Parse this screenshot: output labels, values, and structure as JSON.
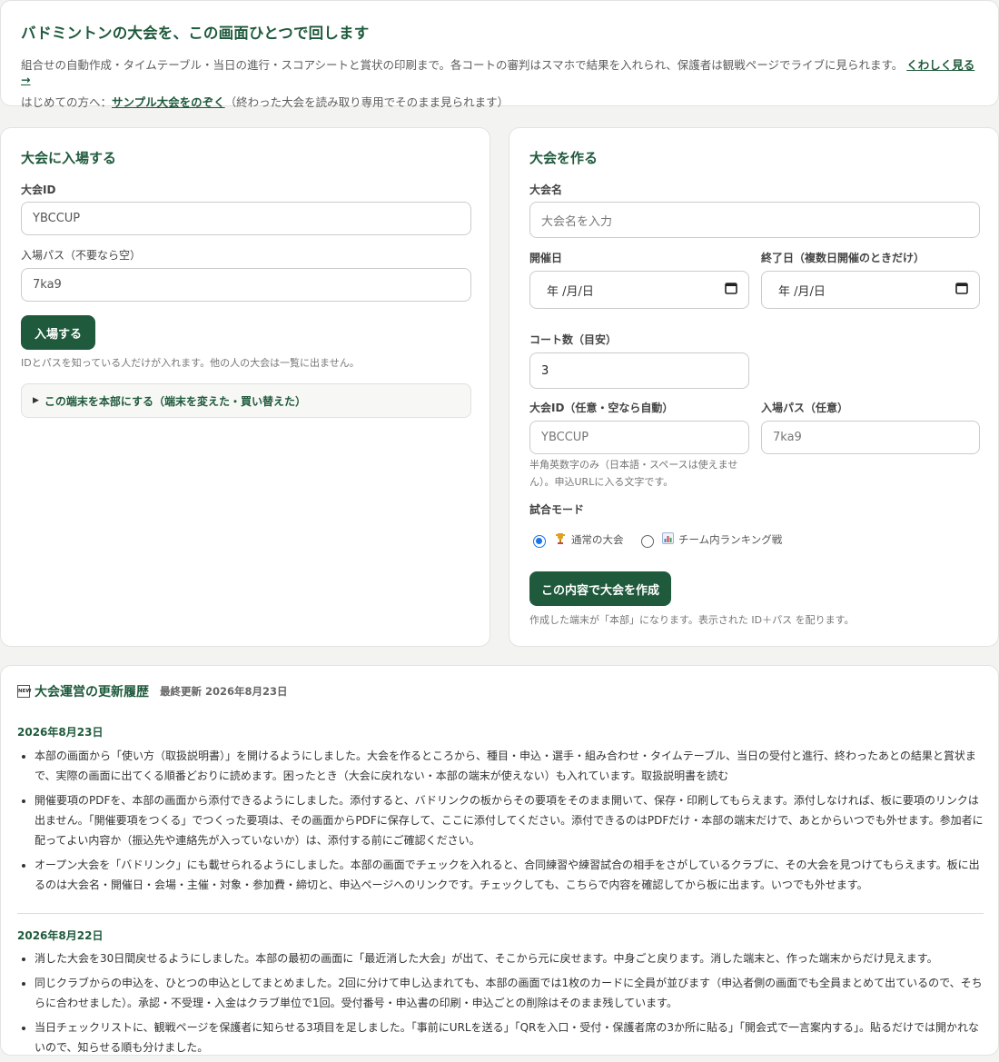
{
  "hero": {
    "title": "バドミントンの大会を、この画面ひとつで回します",
    "desc": "組合せの自動作成・タイムテーブル・当日の進行・スコアシートと賞状の印刷まで。各コートの審判はスマホで結果を入れられ、保護者は観戦ページでライブに見られます。",
    "more_link": "くわしく見る →",
    "first_prefix": "はじめての方へ：",
    "sample_link": "サンプル大会をのぞく",
    "sample_suffix": "（終わった大会を読み取り専用でそのまま見られます）"
  },
  "join": {
    "title": "大会に入場する",
    "id_label": "大会ID",
    "id_value": "YBCCUP",
    "pass_label": "入場パス（不要なら空）",
    "pass_value": "7ka9",
    "button": "入場する",
    "note": "IDとパスを知っている人だけが入れます。他の人の大会は一覧に出ません。",
    "details": "この端末を本部にする（端末を変えた・買い替えた）"
  },
  "create": {
    "title": "大会を作る",
    "name_label": "大会名",
    "name_placeholder": "大会名を入力",
    "start_label": "開催日",
    "start_value": "年 /月/日",
    "end_label": "終了日（複数日開催のときだけ）",
    "end_value": "年 /月/日",
    "courts_label": "コート数（目安）",
    "courts_value": "3",
    "id_label": "大会ID（任意・空なら自動）",
    "id_placeholder": "YBCCUP",
    "pass_label": "入場パス（任意）",
    "pass_placeholder": "7ka9",
    "id_note_1": "半角英数字のみ（日本語・スペースは使えませ",
    "id_note_2": "ん）。申込URLに入る文字です。",
    "mode_label": "試合モード",
    "mode_normal": "通常の大会",
    "mode_ranking": "チーム内ランキング戦",
    "button": "この内容で大会を作成",
    "note": "作成した端末が「本部」になります。表示された ID＋パス を配ります。"
  },
  "history": {
    "title": "大会運営の更新履歴",
    "updated": "最終更新 2026年8月23日",
    "sections": [
      {
        "date": "2026年8月23日",
        "items": [
          "本部の画面から「使い方（取扱説明書）」を開けるようにしました。大会を作るところから、種目・申込・選手・組み合わせ・タイムテーブル、当日の受付と進行、終わったあとの結果と賞状まで、実際の画面に出てくる順番どおりに読めます。困ったとき（大会に戻れない・本部の端末が使えない）も入れています。取扱説明書を読む",
          "開催要項のPDFを、本部の画面から添付できるようにしました。添付すると、バドリンクの板からその要項をそのまま開いて、保存・印刷してもらえます。添付しなければ、板に要項のリンクは出ません。「開催要項をつくる」でつくった要項は、その画面からPDFに保存して、ここに添付してください。添付できるのはPDFだけ・本部の端末だけで、あとからいつでも外せます。参加者に配ってよい内容か（振込先や連絡先が入っていないか）は、添付する前にご確認ください。",
          "オープン大会を「バドリンク」にも載せられるようにしました。本部の画面でチェックを入れると、合同練習や練習試合の相手をさがしているクラブに、その大会を見つけてもらえます。板に出るのは大会名・開催日・会場・主催・対象・参加費・締切と、申込ページへのリンクです。チェックしても、こちらで内容を確認してから板に出ます。いつでも外せます。"
        ]
      },
      {
        "date": "2026年8月22日",
        "items": [
          "消した大会を30日間戻せるようにしました。本部の最初の画面に「最近消した大会」が出て、そこから元に戻せます。中身ごと戻ります。消した端末と、作った端末からだけ見えます。",
          "同じクラブからの申込を、ひとつの申込としてまとめました。2回に分けて申し込まれても、本部の画面では1枚のカードに全員が並びます（申込者側の画面でも全員まとめて出ているので、そちらに合わせました）。承認・不受理・入金はクラブ単位で1回。受付番号・申込書の印刷・申込ごとの削除はそのまま残しています。",
          "当日チェックリストに、観戦ページを保護者に知らせる3項目を足しました。「事前にURLを送る」「QRを入口・受付・保護者席の3か所に貼る」「開会式で一言案内する」。貼るだけでは開かれないので、知らせる順も分けました。"
        ]
      }
    ]
  }
}
